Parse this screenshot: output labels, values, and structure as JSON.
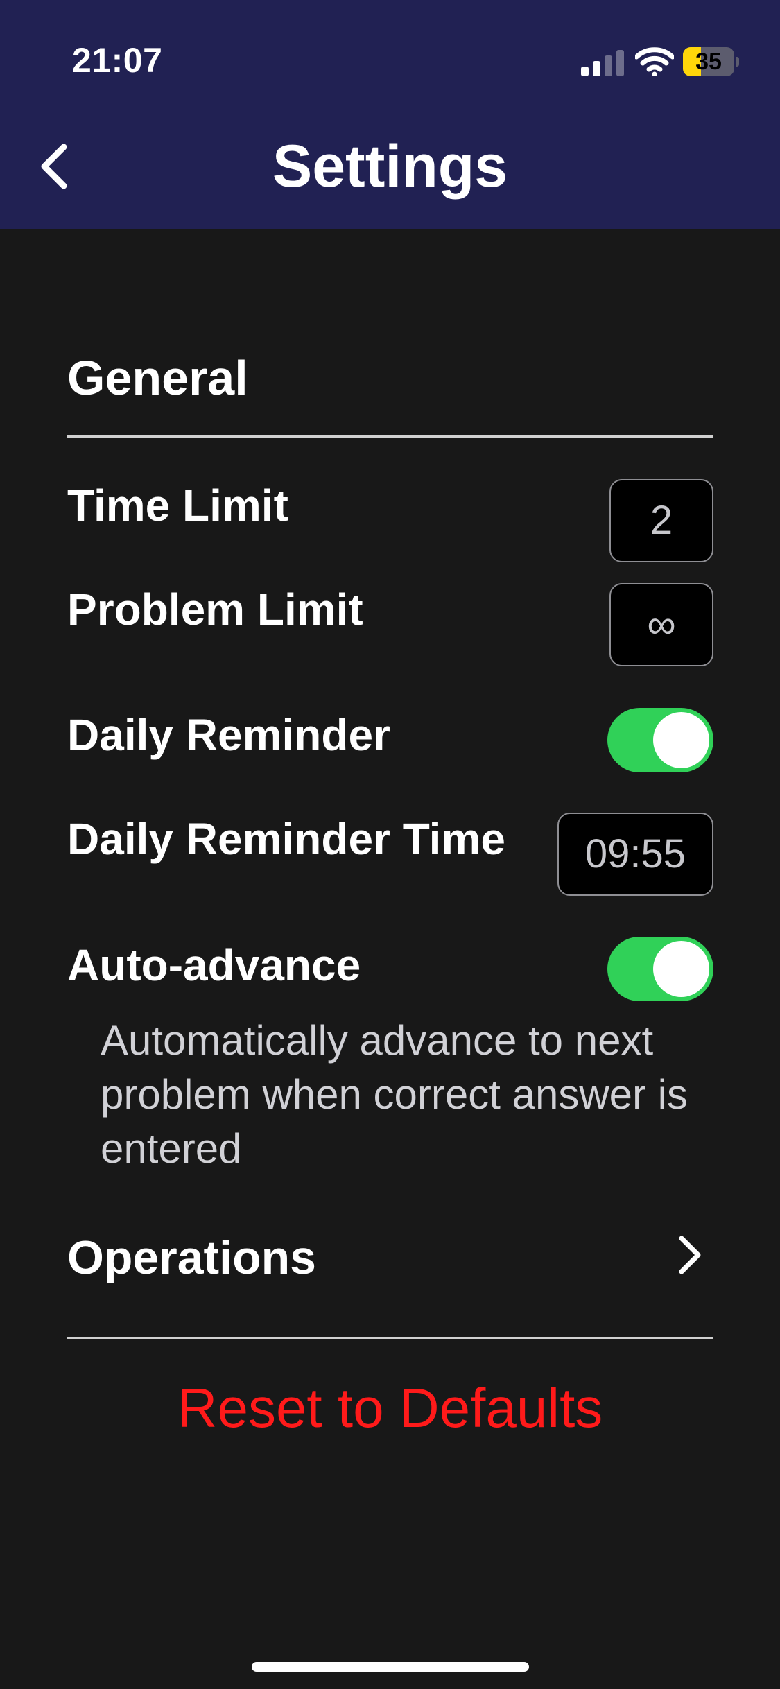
{
  "status_bar": {
    "time": "21:07",
    "battery_level": "35",
    "battery_fraction": 0.35,
    "signal_bars_active": 2,
    "signal_bars_total": 4
  },
  "header": {
    "title": "Settings",
    "back_icon": "chevron-left-icon",
    "background_color": "#212153"
  },
  "general": {
    "section_title": "General",
    "time_limit": {
      "label": "Time Limit",
      "value": "2"
    },
    "problem_limit": {
      "label": "Problem Limit",
      "value": "∞"
    },
    "daily_reminder": {
      "label": "Daily Reminder",
      "enabled": true
    },
    "daily_reminder_time": {
      "label": "Daily Reminder Time",
      "value": "09:55"
    },
    "auto_advance": {
      "label": "Auto-advance",
      "enabled": true,
      "description": "Automatically advance to next problem when correct answer is entered"
    },
    "operations": {
      "label": "Operations",
      "icon": "chevron-right-icon"
    }
  },
  "actions": {
    "reset_label": "Reset to Defaults",
    "reset_color": "#ff1a1a"
  },
  "colors": {
    "toggle_on": "#30d158",
    "background": "#181818"
  }
}
